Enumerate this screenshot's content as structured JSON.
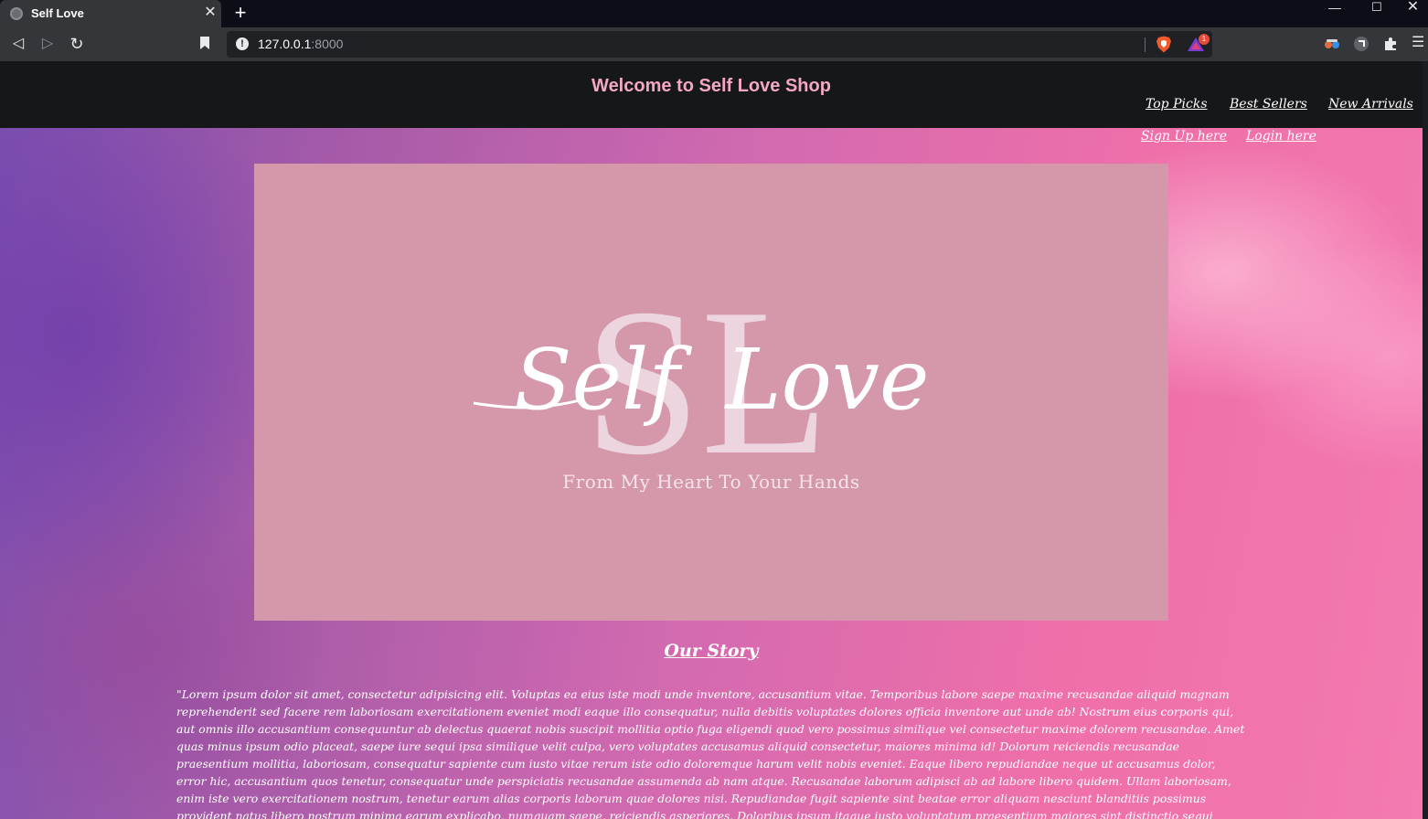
{
  "browser": {
    "tab_title": "Self Love",
    "url_host": "127.0.0.1",
    "url_port": ":8000",
    "rewards_badge_count": "1"
  },
  "header": {
    "title": "Welcome to Self Love Shop",
    "nav": {
      "top_picks": "Top Picks",
      "best_sellers": "Best Sellers",
      "new_arrivals": "New Arrivals",
      "sign_up": "Sign Up here",
      "login": "Login here"
    }
  },
  "hero": {
    "logo_monogram": "SL",
    "logo_word_1": "Self",
    "logo_word_2": "Love",
    "tagline": "From My Heart To Your Hands"
  },
  "story": {
    "heading": "Our Story",
    "body": "\"Lorem ipsum dolor sit amet, consectetur adipisicing elit. Voluptas ea eius iste modi unde inventore, accusantium vitae. Temporibus labore saepe maxime recusandae aliquid magnam reprehenderit sed facere rem laboriosam exercitationem eveniet modi eaque illo consequatur, nulla debitis voluptates dolores officia inventore aut unde ab! Nostrum eius corporis qui, aut omnis illo accusantium consequuntur ab delectus quaerat nobis suscipit mollitia optio fuga eligendi quod vero possimus similique vel consectetur maxime dolorem recusandae. Amet quas minus ipsum odio placeat, saepe iure sequi ipsa similique velit culpa, vero voluptates accusamus aliquid consectetur, maiores minima id! Dolorum reiciendis recusandae praesentium mollitia, laboriosam, consequatur sapiente cum iusto vitae rerum iste odio doloremque harum velit nobis eveniet. Eaque libero repudiandae neque ut accusamus dolor, error hic, accusantium quos tenetur, consequatur unde perspiciatis recusandae assumenda ab nam atque. Recusandae laborum adipisci ab ad labore libero quidem. Ullam laboriosam, enim iste vero exercitationem nostrum, tenetur earum alias corporis laborum quae dolores nisi. Repudiandae fugit sapiente sint beatae error aliquam nesciunt blanditiis possimus provident natus libero nostrum minima earum explicabo, numquam saepe, reiciendis asperiores. Doloribus ipsum itaque iusto voluptatum praesentium maiores sint distinctio sequi dolorem rem? Aperiam excepturi fugit ab voluptatibus quaerat dicta consequatur iusto? Quas vitae eaque laborum molestiae dolores porro non molestias odit ipsum exercitationem! Vero quas rem quod"
  },
  "colors": {
    "header_bg": "#161719",
    "title_pink": "#f3a7c3",
    "hero_bg": "#d597aa",
    "logo_monogram": "#ecd5de"
  }
}
